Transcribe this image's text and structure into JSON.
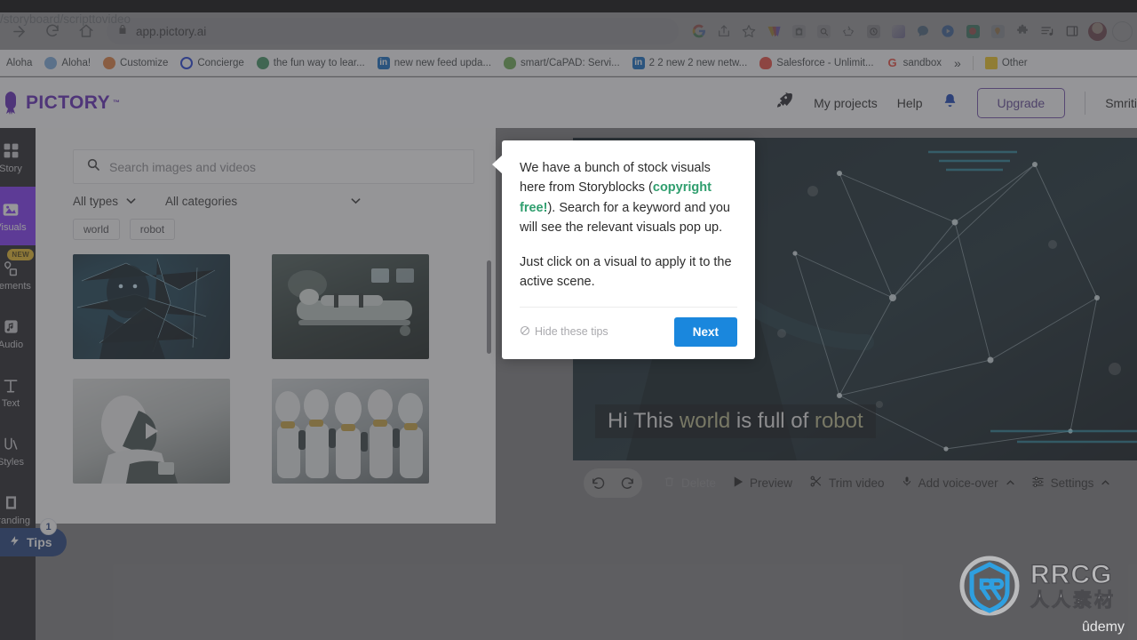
{
  "browser": {
    "url_host": "app.pictory.ai",
    "url_path": "/storyboard/scripttovideo",
    "nav": {
      "forward": "forward-arrow",
      "reload": "reload",
      "home": "home"
    },
    "omni_icons": [
      "google-g-icon",
      "share-icon",
      "star-icon",
      "wallet-icon",
      "camera-icon",
      "lens-icon",
      "recycle-icon",
      "clock-icon",
      "gradient-icon",
      "chat-icon",
      "play-circle-icon",
      "record-icon",
      "map-icon",
      "puzzle-icon",
      "playlist-icon",
      "sidepanel-icon",
      "avatar-icon",
      "profile-icon"
    ],
    "bookmarks": [
      {
        "label": "Aloha",
        "color": "#ffffff"
      },
      {
        "label": "Aloha!",
        "color": "#77a9dd"
      },
      {
        "label": "Customize",
        "color": "#e07b39"
      },
      {
        "label": "Concierge",
        "color": "#1a3ad6"
      },
      {
        "label": "the fun way to lear...",
        "color": "#3a8f5e"
      },
      {
        "label": "new new feed upda...",
        "color": "#0a66c2"
      },
      {
        "label": "smart/CaPAD: Servi...",
        "color": "#6aa84f"
      },
      {
        "label": "2 2 new 2 new netw...",
        "color": "#0a66c2"
      },
      {
        "label": "Salesforce - Unlimit...",
        "color": "#e8443a"
      },
      {
        "label": "sandbox",
        "color": "#ea4335"
      }
    ],
    "overflow_label": "»",
    "other_label": "Other"
  },
  "app_header": {
    "logo_text": "PICTORY",
    "logo_tm": "™",
    "rocket_icon": "rocket-icon",
    "my_projects": "My projects",
    "help": "Help",
    "bell_icon": "bell-icon",
    "upgrade": "Upgrade",
    "user_name": "Smriti"
  },
  "sidebar": {
    "items": [
      {
        "label": "Story",
        "icon": "grid-icon",
        "active": false,
        "badge": ""
      },
      {
        "label": "Visuals",
        "icon": "image-icon",
        "active": true,
        "badge": ""
      },
      {
        "label": "Elements",
        "icon": "shapes-icon",
        "active": false,
        "badge": "NEW"
      },
      {
        "label": "Audio",
        "icon": "music-note-icon",
        "active": false,
        "badge": ""
      },
      {
        "label": "Text",
        "icon": "text-icon",
        "active": false,
        "badge": ""
      },
      {
        "label": "Styles",
        "icon": "styles-icon",
        "active": false,
        "badge": ""
      },
      {
        "label": "Branding",
        "icon": "branding-icon",
        "active": false,
        "badge": ""
      }
    ],
    "tips": {
      "label": "Tips",
      "count": "1",
      "icon": "lightning-icon"
    }
  },
  "library": {
    "search": {
      "placeholder": "Search images and videos",
      "value": "",
      "icon": "search-icon"
    },
    "filters": [
      {
        "label": "All types",
        "icon": "chevron-down-icon"
      },
      {
        "label": "All categories",
        "icon": "chevron-down-icon"
      }
    ],
    "chips": [
      "world",
      "robot"
    ],
    "thumbnails": [
      {
        "name": "hologram-human-network",
        "kind": "image"
      },
      {
        "name": "robot-on-stretcher",
        "kind": "image"
      },
      {
        "name": "white-android-head",
        "kind": "video"
      },
      {
        "name": "robot-army-row",
        "kind": "image"
      }
    ]
  },
  "preview": {
    "caption_parts": [
      {
        "text": "Hi This ",
        "highlight": false
      },
      {
        "text": "world",
        "highlight": true
      },
      {
        "text": " is full of ",
        "highlight": false
      },
      {
        "text": "robot",
        "highlight": true
      }
    ],
    "caption_full": "Hi This world is full of robot",
    "toolbar": {
      "undo": "undo-icon",
      "redo": "redo-icon",
      "delete": "Delete",
      "preview": "Preview",
      "trim": "Trim video",
      "voiceover": "Add voice-over",
      "settings": "Settings"
    }
  },
  "tooltip": {
    "line1_a": "We have a bunch of stock visuals here from Storyblocks (",
    "line1_green": "copyright free!",
    "line1_b": "). Search for a keyword and you will see the relevant visuals pop up.",
    "line2": "Just click on a visual to apply it to the active scene.",
    "hide_tips": "Hide these tips",
    "next": "Next",
    "hide_icon": "no-entry-icon"
  },
  "watermark": {
    "brand": "RRCG",
    "brand_cn": "人人素材",
    "platform": "ûdemy"
  },
  "colors": {
    "accent_purple": "#7b2ff7",
    "logo_purple": "#5b21b6",
    "next_blue": "#1a87dd",
    "tips_navy": "#1b3a7a",
    "green": "#2f9e6e",
    "badge_yellow": "#e9b824"
  }
}
